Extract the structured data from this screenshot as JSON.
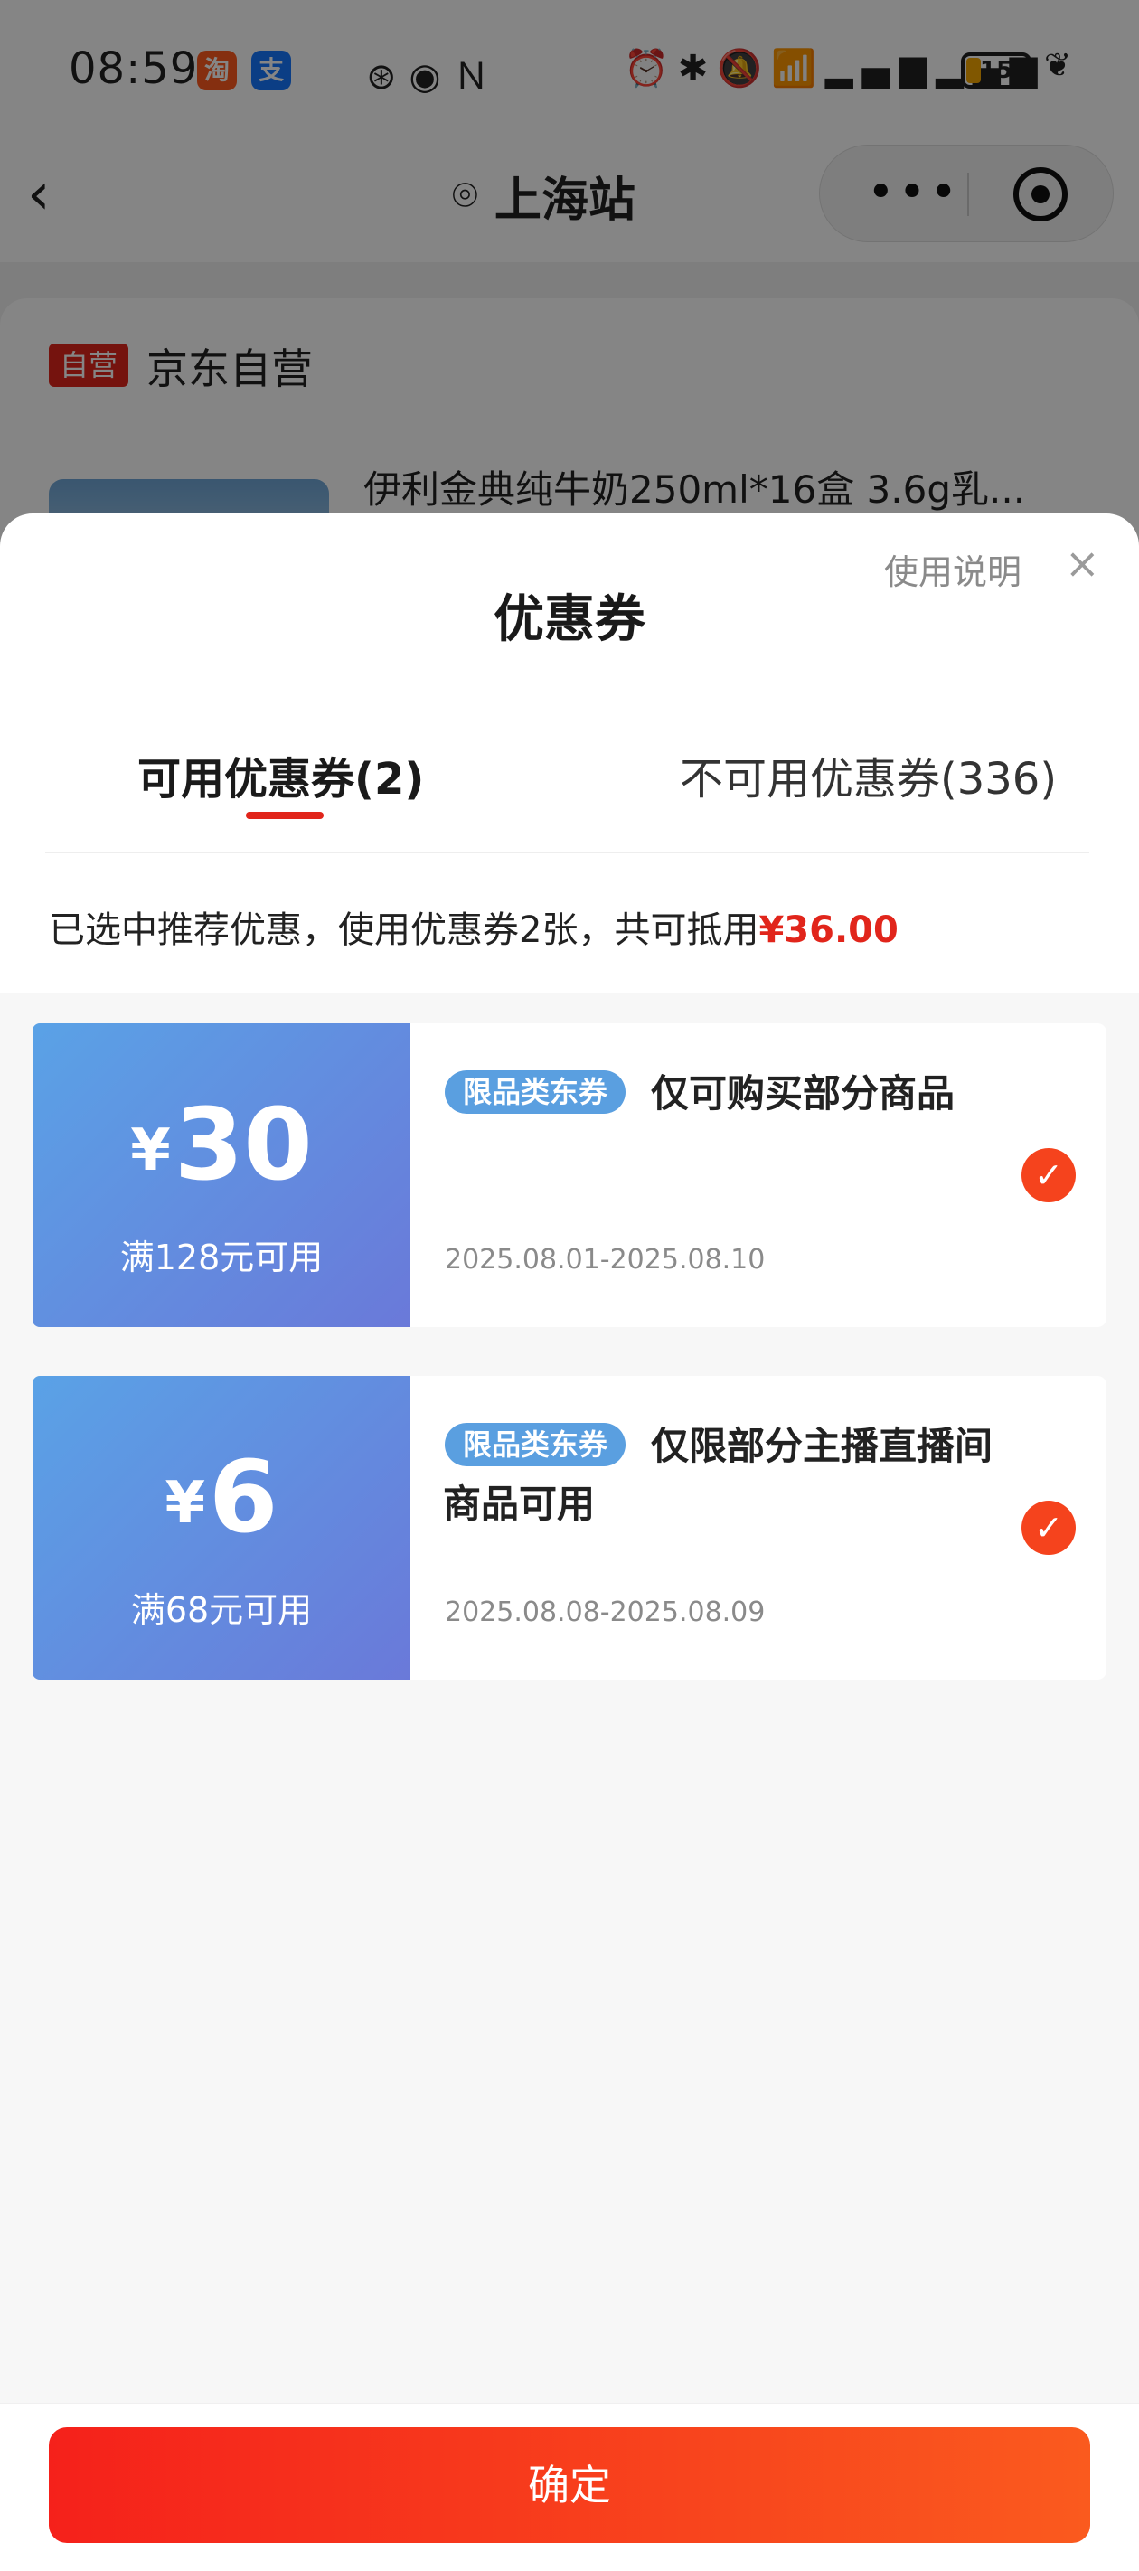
{
  "status_bar": {
    "time": "08:59",
    "app_badges": [
      {
        "label": "淘",
        "color": "#ff5a1f"
      },
      {
        "label": "支",
        "color": "#1677ff"
      }
    ],
    "battery_level": "15"
  },
  "nav": {
    "location": "上海站"
  },
  "background_page": {
    "self_operated_tag": "自营",
    "shop_name": "京东自营",
    "product_title": "伊利金典纯牛奶250ml*16盒 3.6g乳..."
  },
  "sheet": {
    "title": "优惠券",
    "usage_link": "使用说明",
    "close_icon": "×",
    "tabs": [
      {
        "label": "可用优惠券(2)",
        "active": true
      },
      {
        "label": "不可用优惠券(336)",
        "active": false
      }
    ],
    "summary_prefix": "已选中推荐优惠，使用优惠券2张，共可抵用",
    "summary_amount": "¥36.00"
  },
  "coupons": [
    {
      "currency": "¥",
      "amount": "30",
      "threshold": "满128元可用",
      "tag": "限品类东券",
      "description": "仅可购买部分商品",
      "date_range": "2025.08.01-2025.08.10",
      "selected": true
    },
    {
      "currency": "¥",
      "amount": "6",
      "threshold": "满68元可用",
      "tag": "限品类东券",
      "description": "仅限部分主播直播间商品可用",
      "date_range": "2025.08.08-2025.08.09",
      "selected": true
    }
  ],
  "confirm_button": "确定",
  "colors": {
    "accent_red": "#e1251b",
    "coupon_gradient_start": "#5aa2e6",
    "coupon_gradient_end": "#6a79d9",
    "check_orange": "#f5431d"
  }
}
